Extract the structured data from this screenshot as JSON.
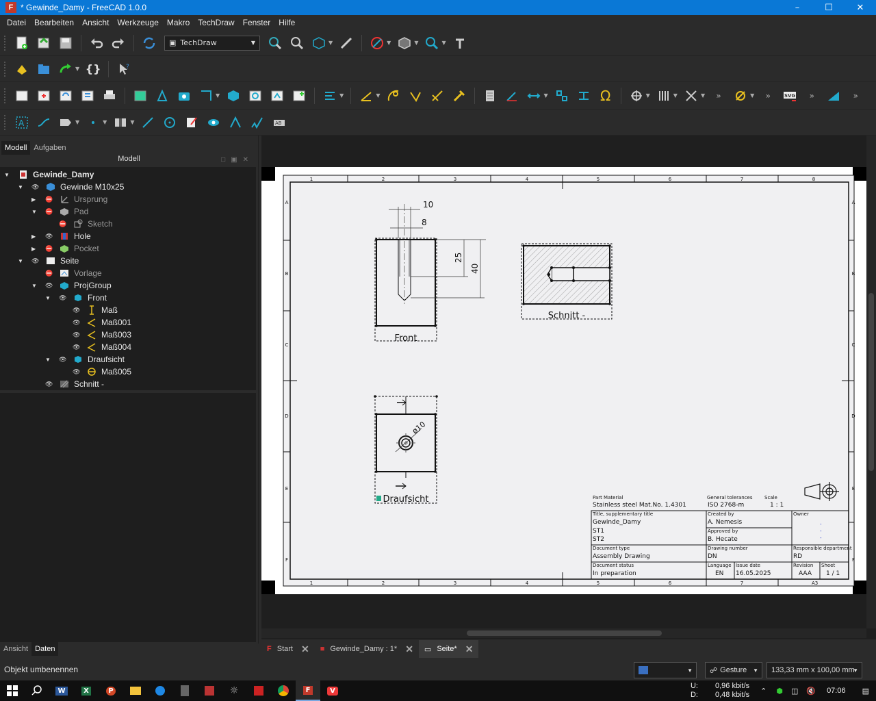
{
  "window": {
    "title": "* Gewinde_Damy - FreeCAD 1.0.0",
    "app_icon": "F"
  },
  "menu": [
    "Datei",
    "Bearbeiten",
    "Ansicht",
    "Werkzeuge",
    "Makro",
    "TechDraw",
    "Fenster",
    "Hilfe"
  ],
  "workbench": "TechDraw",
  "panel_tabs": [
    "Modell",
    "Aufgaben"
  ],
  "tree_header": "Modell",
  "tree": [
    {
      "label": "Gewinde_Damy"
    },
    {
      "label": "Gewinde M10x25"
    },
    {
      "label": "Ursprung"
    },
    {
      "label": "Pad"
    },
    {
      "label": "Sketch"
    },
    {
      "label": "Hole"
    },
    {
      "label": "Pocket"
    },
    {
      "label": "Seite"
    },
    {
      "label": "Vorlage"
    },
    {
      "label": "ProjGroup"
    },
    {
      "label": "Front"
    },
    {
      "label": "Maß"
    },
    {
      "label": "Maß001"
    },
    {
      "label": "Maß003"
    },
    {
      "label": "Maß004"
    },
    {
      "label": "Draufsicht"
    },
    {
      "label": "Maß005"
    },
    {
      "label": "Schnitt  -"
    }
  ],
  "bottom_tabs": [
    "Ansicht",
    "Daten"
  ],
  "doc_tabs": [
    {
      "label": "Start"
    },
    {
      "label": "Gewinde_Damy : 1*"
    },
    {
      "label": "Seite*"
    }
  ],
  "status": {
    "message": "Objekt umbenennen",
    "navigation": "Gesture",
    "size": "133,33 mm x 100,00 mm"
  },
  "drawing": {
    "col_labels": [
      "1",
      "2",
      "3",
      "4",
      "5",
      "6",
      "7",
      "8"
    ],
    "row_labels": [
      "A",
      "B",
      "C",
      "D",
      "E",
      "F"
    ],
    "dim_10": "10",
    "dim_8": "8",
    "dim_25": "25",
    "dim_40": "40",
    "dim_d10": "ø10",
    "front_label": "Front",
    "schnitt_label": "Schnitt  -",
    "draufsicht_label": "Draufsicht",
    "tb": {
      "part_material_h": "Part Material",
      "part_material": "Stainless steel Mat.No. 1.4301",
      "gen_tol_h": "General tolerances",
      "gen_tol": "ISO 2768-m",
      "scale_h": "Scale",
      "scale": "1 : 1",
      "title_h": "Title, supplementary title",
      "title": "Gewinde_Damy",
      "st1": "ST1",
      "st2": "ST2",
      "created_h": "Created by",
      "created": "A. Nemesis",
      "approved_h": "Approved by",
      "approved": "B. Hecate",
      "owner_h": "Owner",
      "owner_dash": "-",
      "doctype_h": "Document type",
      "doctype": "Assembly Drawing",
      "drawnum_h": "Drawing number",
      "drawnum": "DN",
      "resp_h": "Responsible department",
      "resp": "RD",
      "status_h": "Document status",
      "status": "In preparation",
      "lang_h": "Language",
      "lang": "EN",
      "issue_h": "Issue date",
      "issue": "16.05.2025",
      "rev_h": "Revision",
      "rev": "AAA",
      "sheet_h": "Sheet",
      "sheet": "1 / 1",
      "format": "A3"
    }
  },
  "taskbar": {
    "net_up_label": "U:",
    "net_up": "0,96 kbit/s",
    "net_down_label": "D:",
    "net_down": "0,48 kbit/s",
    "time": "07:06"
  }
}
